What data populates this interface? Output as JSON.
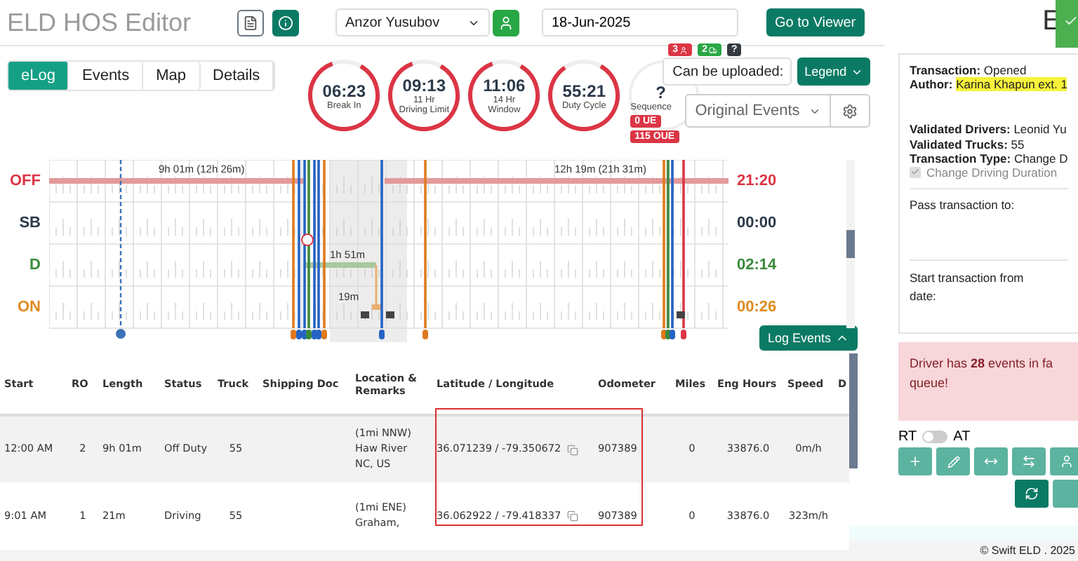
{
  "header": {
    "title": "ELD HOS Editor",
    "driver": "Anzor Yusubov",
    "date": "18-Jun-2025",
    "viewer_button": "Go to Viewer"
  },
  "tabs": [
    {
      "label": "eLog",
      "selected": true
    },
    {
      "label": "Events",
      "selected": false
    },
    {
      "label": "Map",
      "selected": false
    },
    {
      "label": "Details",
      "selected": false
    }
  ],
  "gauges": [
    {
      "value": "06:23",
      "label": "Break In",
      "level": 0.86
    },
    {
      "value": "09:13",
      "sublabel": "11 Hr",
      "label": "Driving Limit",
      "level": 0.86
    },
    {
      "value": "11:06",
      "sublabel": "14 Hr",
      "label": "Window",
      "level": 0.86
    },
    {
      "value": "55:21",
      "label": "Duty Cycle",
      "level": 0.82
    }
  ],
  "sequence": {
    "value": "?",
    "label": "Sequence",
    "badges": [
      "0 UE",
      "115 OUE"
    ]
  },
  "upload_badges": [
    {
      "count": "3",
      "kind": "driver",
      "color": "#dc3545"
    },
    {
      "count": "2",
      "kind": "truck",
      "color": "#28a745"
    },
    {
      "count": "?",
      "kind": "unknown",
      "color": "#343a40"
    }
  ],
  "upload_select": "Can be uploaded:",
  "legend_button": "Legend",
  "events_select": "Original Events",
  "graph": {
    "statuses": [
      {
        "label": "OFF",
        "total": "21:20",
        "color": "#dc3545"
      },
      {
        "label": "SB",
        "total": "00:00",
        "color": "#2b3a4a"
      },
      {
        "label": "D",
        "total": "02:14",
        "color": "#3a8a3a"
      },
      {
        "label": "ON",
        "total": "00:26",
        "color": "#e08a1e"
      }
    ],
    "labels": [
      "9h 01m (12h 26m)",
      "12h 19m (21h 31m)",
      "1h 51m",
      "19m"
    ]
  },
  "log_events_button": "Log Events",
  "table": {
    "columns": [
      "Start",
      "RO",
      "Length",
      "Status",
      "Truck",
      "Shipping Doc",
      "Location & Remarks",
      "Latitude / Longitude",
      "Odometer",
      "Miles",
      "Eng Hours",
      "Speed",
      "D"
    ],
    "rows": [
      {
        "selected": true,
        "cells": [
          "12:00 AM",
          "2",
          "9h 01m",
          "Off Duty",
          "55",
          "",
          "(1mi NNW) Haw River NC, US",
          "36.071239 / -79.350672",
          "907389",
          "0",
          "33876.0",
          "0m/h",
          ""
        ]
      },
      {
        "selected": false,
        "cells": [
          "9:01 AM",
          "1",
          "21m",
          "Driving",
          "55",
          "",
          "(1mi ENE) Graham,",
          "36.062922 / -79.418337",
          "907389",
          "0",
          "33876.0",
          "323m/h",
          ""
        ]
      }
    ]
  },
  "side": {
    "title": "E",
    "transaction_label": "Transaction:",
    "transaction": "Opened",
    "author_label": "Author:",
    "author": "Karina Khapun ext. 1",
    "drivers_label": "Validated Drivers:",
    "drivers": "Leonid Yu",
    "trucks_label": "Validated Trucks:",
    "trucks": "55",
    "type_label": "Transaction Type:",
    "type": "Change D",
    "change_duration": {
      "label": "Change Driving Duration",
      "checked": true,
      "disabled": true
    },
    "pass_label": "Pass transaction to:",
    "start_label": "Start transaction from date:",
    "alert": "Driver has **28** events in fa queue!",
    "rt": "RT",
    "at": "AT",
    "toggle_on": false
  },
  "footer": "© Swift ELD . 2025"
}
